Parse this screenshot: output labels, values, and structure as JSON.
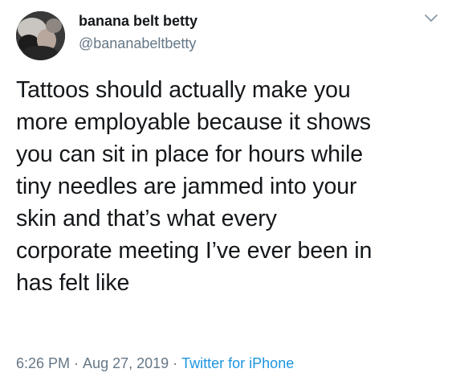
{
  "author": {
    "display_name": "banana belt betty",
    "handle": "@bananabeltbetty"
  },
  "tweet": {
    "lines": [
      "Tattoos should actually make you",
      "more employable because it shows",
      "you can sit in place for hours while",
      "tiny needles are jammed into your",
      "skin and that’s what every",
      "corporate meeting I’ve ever been in",
      "has felt like"
    ]
  },
  "meta": {
    "time": "6:26 PM",
    "separator": "·",
    "date": "Aug 27, 2019",
    "source": "Twitter for iPhone"
  },
  "icons": {
    "caret": "chevron-down-icon",
    "avatar": "avatar"
  },
  "colors": {
    "text": "#14171a",
    "secondary": "#657786",
    "link": "#1b95e0",
    "background": "#ffffff"
  }
}
